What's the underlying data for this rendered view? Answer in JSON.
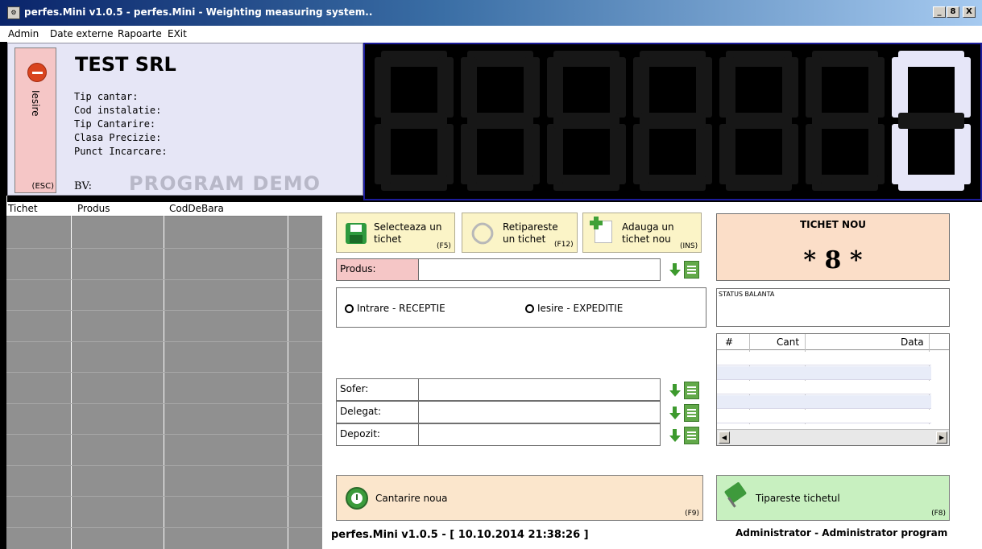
{
  "window": {
    "title": "perfes.Mini v1.0.5 - perfes.Mini - Weighting measuring system..",
    "icon": "app-icon",
    "controls": [
      "_",
      "8",
      "X"
    ]
  },
  "menu": {
    "items": [
      "Admin",
      "Date externe",
      "Rapoarte",
      "EXit"
    ]
  },
  "exit_button": {
    "label": "Iesire",
    "shortcut": "(ESC)",
    "icon": "no-entry-icon"
  },
  "company": {
    "name": "TEST SRL",
    "fields": [
      "Tip cantar:",
      "Cod instalatie:",
      "Tip Cantarire:",
      "Clasa Precizie:",
      "Punct Incarcare:"
    ],
    "bv_label": "BV:",
    "watermark": "PROGRAM DEMO"
  },
  "display": {
    "digits": [
      "",
      "",
      "",
      "",
      "",
      "",
      "0"
    ]
  },
  "tickets_table": {
    "columns": [
      "Tichet",
      "Produs",
      "CodDeBara"
    ]
  },
  "toolbar": {
    "select": {
      "line1": "Selecteaza un",
      "line2": "tichet",
      "shortcut": "(F5)"
    },
    "reprint": {
      "line1": "Retipareste",
      "line2": "un tichet",
      "shortcut": "(F12)"
    },
    "add": {
      "line1": "Adauga un",
      "line2": "tichet nou",
      "shortcut": "(INS)"
    }
  },
  "form": {
    "produs_label": "Produs:",
    "sofer_label": "Sofer:",
    "delegat_label": "Delegat:",
    "depozit_label": "Depozit:",
    "radio_in": "Intrare - RECEPTIE",
    "radio_out": "Iesire - EXPEDITIE"
  },
  "ticket": {
    "title": "TICHET NOU",
    "number": "* 8 *",
    "status_label": "STATUS BALANTA"
  },
  "grid": {
    "columns": [
      "#",
      "Cant",
      "Data"
    ]
  },
  "actions": {
    "new_weighing": {
      "label": "Cantarire noua",
      "shortcut": "(F9)"
    },
    "print_ticket": {
      "label": "Tipareste tichetul",
      "shortcut": "(F8)"
    }
  },
  "status": {
    "version": "perfes.Mini v1.0.5 - [ 10.10.2014 21:38:26 ]",
    "user": "Administrator - Administrator program"
  },
  "colors": {
    "titlebar": "#0a246a",
    "info_panel": "#e6e6f6",
    "exit_button": "#f5c6c6",
    "toolbar_button": "#fbf4c7",
    "ticket_box": "#fbdec8",
    "print_button": "#c8f0c0",
    "digit_on": "#e6e6f8",
    "digit_off": "#171717"
  }
}
